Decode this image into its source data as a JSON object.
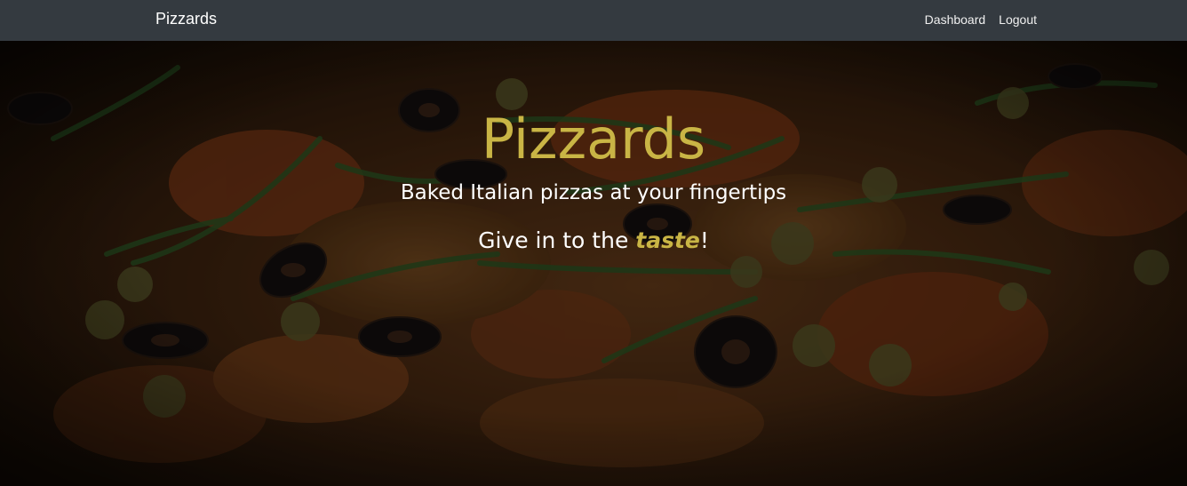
{
  "navbar": {
    "brand": "Pizzards",
    "links": [
      {
        "label": "Dashboard"
      },
      {
        "label": "Logout"
      }
    ]
  },
  "hero": {
    "title": "Pizzards",
    "subtitle": "Baked Italian pizzas at your fingertips",
    "tagline_before": "Give in to the ",
    "tagline_emphasis": "taste",
    "tagline_after": "!"
  },
  "colors": {
    "navbar_bg": "#343a40",
    "accent_gold": "#c9b545",
    "text_white": "#ffffff"
  }
}
